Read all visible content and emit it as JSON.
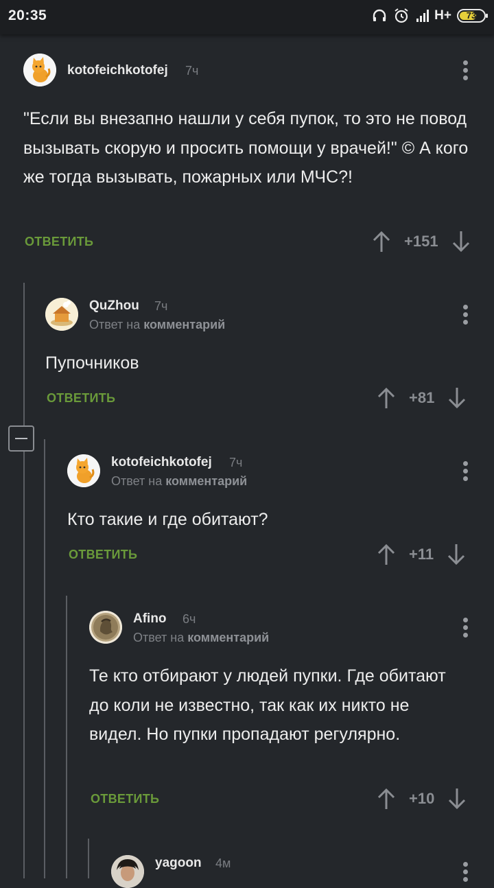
{
  "status_bar": {
    "time": "20:35",
    "network": "H+",
    "battery": "73",
    "battery_level": 0.73,
    "icons": [
      "headset-icon",
      "alarm-icon",
      "signal-icon"
    ]
  },
  "colors": {
    "background": "#24272b",
    "reply_accent": "#6a9a3a",
    "muted": "#7a7d82"
  },
  "comments": [
    {
      "author": "kotofeichkotofej",
      "time": "7ч",
      "reply_prefix": "",
      "reply_target": "",
      "text": "\"Если вы внезапно нашли у себя пупок, то это не повод вызывать скорую и просить помощи у врачей!\" © А кого же тогда вызывать, пожарных или МЧС?!",
      "reply_label": "ОТВЕТИТЬ",
      "score": "+151",
      "avatar": "cat-avatar"
    },
    {
      "author": "QuZhou",
      "time": "7ч",
      "reply_prefix": "Ответ на",
      "reply_target": "комментарий",
      "text": "Пупочников",
      "reply_label": "ОТВЕТИТЬ",
      "score": "+81",
      "avatar": "house-avatar"
    },
    {
      "author": "kotofeichkotofej",
      "time": "7ч",
      "reply_prefix": "Ответ на",
      "reply_target": "комментарий",
      "text": "Кто такие и где обитают?",
      "reply_label": "ОТВЕТИТЬ",
      "score": "+11",
      "avatar": "cat-avatar"
    },
    {
      "author": "Afino",
      "time": "6ч",
      "reply_prefix": "Ответ на",
      "reply_target": "комментарий",
      "text": "Те кто отбирают у людей пупки. Где обитают до коли не известно, так как их никто не видел. Но пупки пропадают регулярно.",
      "reply_label": "ОТВЕТИТЬ",
      "score": "+10",
      "avatar": "coin-avatar"
    },
    {
      "author": "yagoon",
      "time": "4м",
      "avatar": "person-avatar"
    }
  ]
}
